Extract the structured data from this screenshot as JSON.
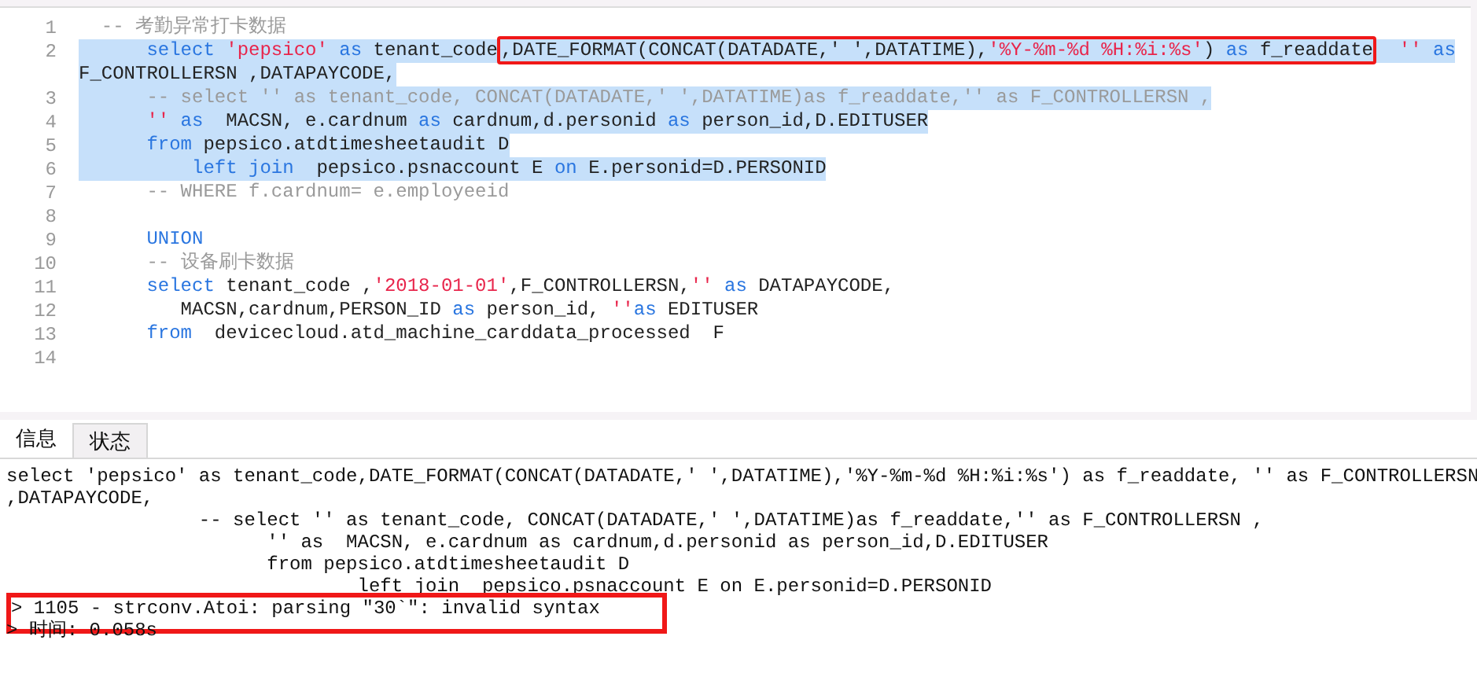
{
  "editor": {
    "lines": [
      {
        "number": "1",
        "selected": false,
        "tokens": [
          {
            "kind": "comment",
            "text": "  -- 考勤异常打卡数据"
          }
        ]
      },
      {
        "number": "2",
        "selected": true,
        "tokens": [
          {
            "kind": "keyword",
            "text": "      select"
          },
          {
            "kind": "string",
            "text": " 'pepsico'"
          },
          {
            "kind": "keyword",
            "text": " as"
          },
          {
            "kind": "plain",
            "text": " tenant_code"
          },
          {
            "kind": "plain",
            "text": ",DATE_FORMAT(CONCAT(DATADATE,' ',DATATIME),",
            "annotated": true
          },
          {
            "kind": "string",
            "text": "'%Y-%m-%d %H:%i:%s'",
            "annotated": true
          },
          {
            "kind": "plain",
            "text": ") ",
            "annotated": true
          },
          {
            "kind": "keyword",
            "text": "as",
            "annotated": true
          },
          {
            "kind": "plain",
            "text": " f_readdate",
            "annotated": true
          },
          {
            "kind": "string",
            "text": "  ''"
          },
          {
            "kind": "keyword",
            "text": " as"
          }
        ]
      },
      {
        "selected": true,
        "tokens": [
          {
            "kind": "plain",
            "text": "F_CONTROLLERSN ,DATAPAYCODE,"
          }
        ]
      },
      {
        "number": "3",
        "selected": true,
        "tokens": [
          {
            "kind": "comment",
            "text": "      -- select '' as tenant_code, CONCAT(DATADATE,' ',DATATIME)as f_readdate,'' as F_CONTROLLERSN ,"
          }
        ]
      },
      {
        "number": "4",
        "selected": true,
        "tokens": [
          {
            "kind": "string",
            "text": "      ''"
          },
          {
            "kind": "keyword",
            "text": " as"
          },
          {
            "kind": "plain",
            "text": "  MACSN, e.cardnum "
          },
          {
            "kind": "keyword",
            "text": "as"
          },
          {
            "kind": "plain",
            "text": " cardnum,d.personid "
          },
          {
            "kind": "keyword",
            "text": "as"
          },
          {
            "kind": "plain",
            "text": " person_id,D.EDITUSER"
          }
        ]
      },
      {
        "number": "5",
        "selected": true,
        "tokens": [
          {
            "kind": "keyword",
            "text": "      from"
          },
          {
            "kind": "plain",
            "text": " pepsico.atdtimesheetaudit D"
          }
        ]
      },
      {
        "number": "6",
        "selected": true,
        "tokens": [
          {
            "kind": "keyword",
            "text": "          left join"
          },
          {
            "kind": "plain",
            "text": "  pepsico.psnaccount E "
          },
          {
            "kind": "keyword",
            "text": "on"
          },
          {
            "kind": "plain",
            "text": " E.personid=D.PERSONID"
          }
        ]
      },
      {
        "number": "7",
        "selected": false,
        "tokens": [
          {
            "kind": "comment",
            "text": "      -- WHERE f.cardnum= e.employeeid"
          }
        ]
      },
      {
        "number": "8",
        "selected": false
      },
      {
        "number": "9",
        "selected": false,
        "tokens": [
          {
            "kind": "keyword",
            "text": "      UNION"
          }
        ]
      },
      {
        "number": "10",
        "selected": false,
        "tokens": [
          {
            "kind": "comment",
            "text": "      -- 设备刷卡数据"
          }
        ]
      },
      {
        "number": "11",
        "selected": false,
        "tokens": [
          {
            "kind": "keyword",
            "text": "      select"
          },
          {
            "kind": "plain",
            "text": " tenant_code ,"
          },
          {
            "kind": "string",
            "text": "'2018-01-01'"
          },
          {
            "kind": "plain",
            "text": ",F_CONTROLLERSN,"
          },
          {
            "kind": "string",
            "text": "''"
          },
          {
            "kind": "keyword",
            "text": " as"
          },
          {
            "kind": "plain",
            "text": " DATAPAYCODE,"
          }
        ]
      },
      {
        "number": "12",
        "selected": false,
        "tokens": [
          {
            "kind": "plain",
            "text": "         MACSN,cardnum,PERSON_ID "
          },
          {
            "kind": "keyword",
            "text": "as"
          },
          {
            "kind": "plain",
            "text": " person_id, "
          },
          {
            "kind": "string",
            "text": "''"
          },
          {
            "kind": "keyword",
            "text": "as"
          },
          {
            "kind": "plain",
            "text": " EDITUSER"
          }
        ]
      },
      {
        "number": "13",
        "selected": false,
        "tokens": [
          {
            "kind": "keyword",
            "text": "      from"
          },
          {
            "kind": "plain",
            "text": "  devicecloud.atd_machine_carddata_processed  F"
          }
        ]
      },
      {
        "number": "14",
        "selected": false
      }
    ]
  },
  "tabs": [
    {
      "label": "信息",
      "selected": true
    },
    {
      "label": "状态",
      "selected": false
    }
  ],
  "output": {
    "lines": [
      {
        "text": "select 'pepsico' as tenant_code,DATE_FORMAT(CONCAT(DATADATE,' ',DATATIME),'%Y-%m-%d %H:%i:%s') as f_readdate, '' as F_CONTROLLERSN"
      },
      {
        "text": ",DATAPAYCODE,"
      },
      {
        "text": "                 -- select '' as tenant_code, CONCAT(DATADATE,' ',DATATIME)as f_readdate,'' as F_CONTROLLERSN ,"
      },
      {
        "text": "                       '' as  MACSN, e.cardnum as cardnum,d.personid as person_id,D.EDITUSER"
      },
      {
        "text": "                       from pepsico.atdtimesheetaudit D"
      },
      {
        "text": "                               left join  pepsico.psnaccount E on E.personid=D.PERSONID"
      },
      {
        "text": "> 1105 - strconv.Atoi: parsing \"30`\": invalid syntax",
        "annotated": true
      },
      {
        "text": "> 时间: 0.058s"
      }
    ]
  }
}
